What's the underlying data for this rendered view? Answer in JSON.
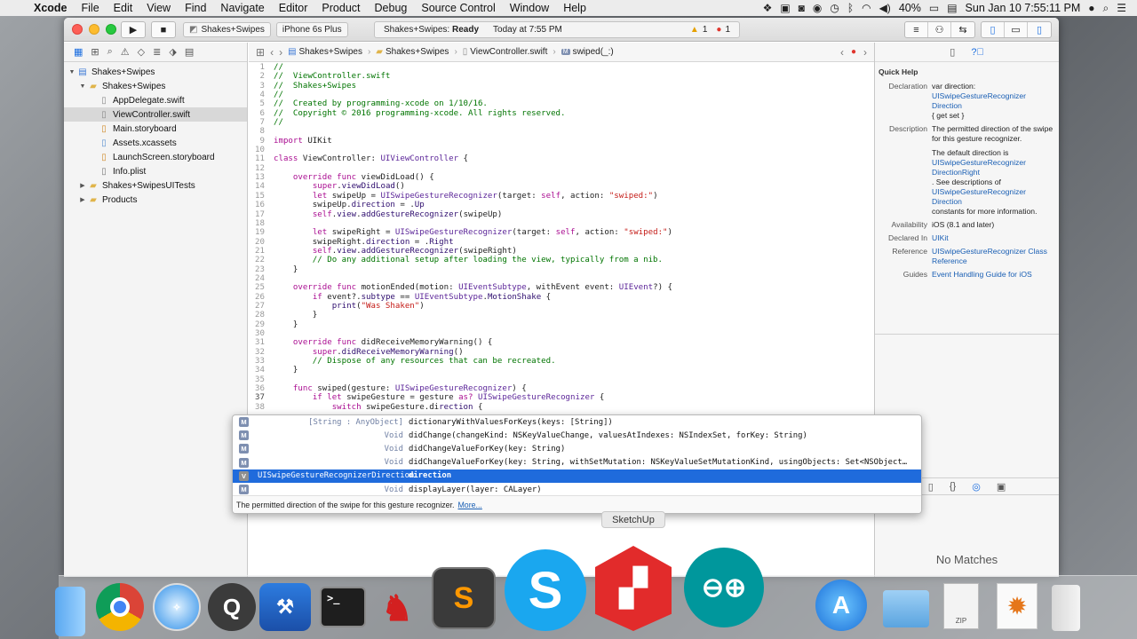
{
  "menubar": {
    "app": "Xcode",
    "items": [
      "File",
      "Edit",
      "View",
      "Find",
      "Navigate",
      "Editor",
      "Product",
      "Debug",
      "Source Control",
      "Window",
      "Help"
    ],
    "battery": "40%",
    "clock": "Sun Jan 10   7:55:11 PM"
  },
  "toolbar": {
    "scheme": "Shakes+Swipes",
    "device": "iPhone 6s Plus",
    "status_project": "Shakes+Swipes:",
    "status_state": "Ready",
    "status_time": "Today at 7:55 PM",
    "warnings": "1",
    "errors": "1"
  },
  "navigator": {
    "items": [
      {
        "label": "Shakes+Swipes",
        "level": 0,
        "arrow": "▼",
        "icon": "project-icon"
      },
      {
        "label": "Shakes+Swipes",
        "level": 1,
        "arrow": "▼",
        "icon": "folder-icon"
      },
      {
        "label": "AppDelegate.swift",
        "level": 2,
        "arrow": "",
        "icon": "swift-file-icon"
      },
      {
        "label": "ViewController.swift",
        "level": 2,
        "arrow": "",
        "icon": "swift-file-icon",
        "selected": true
      },
      {
        "label": "Main.storyboard",
        "level": 2,
        "arrow": "",
        "icon": "storyboard-icon"
      },
      {
        "label": "Assets.xcassets",
        "level": 2,
        "arrow": "",
        "icon": "assets-icon"
      },
      {
        "label": "LaunchScreen.storyboard",
        "level": 2,
        "arrow": "",
        "icon": "storyboard-icon"
      },
      {
        "label": "Info.plist",
        "level": 2,
        "arrow": "",
        "icon": "plist-icon"
      },
      {
        "label": "Shakes+SwipesUITests",
        "level": 1,
        "arrow": "▶",
        "icon": "folder-icon"
      },
      {
        "label": "Products",
        "level": 1,
        "arrow": "▶",
        "icon": "folder-icon"
      }
    ]
  },
  "jumpbar": {
    "crumbs": [
      "Shakes+Swipes",
      "Shakes+Swipes",
      "ViewController.swift",
      "swiped(_:)"
    ]
  },
  "code": {
    "lines": [
      [
        [
          "c",
          "//"
        ]
      ],
      [
        [
          "c",
          "//  ViewController.swift"
        ]
      ],
      [
        [
          "c",
          "//  Shakes+Swipes"
        ]
      ],
      [
        [
          "c",
          "//"
        ]
      ],
      [
        [
          "c",
          "//  Created by programming-xcode on 1/10/16."
        ]
      ],
      [
        [
          "c",
          "//  Copyright © 2016 programming-xcode. All rights reserved."
        ]
      ],
      [
        [
          "c",
          "//"
        ]
      ],
      [],
      [
        [
          "k",
          "import"
        ],
        [
          "ct",
          " UIKit"
        ]
      ],
      [],
      [
        [
          "k",
          "class"
        ],
        [
          "ct",
          " ViewController: "
        ],
        [
          "t",
          "UIViewController"
        ],
        [
          "ct",
          " {"
        ]
      ],
      [],
      [
        [
          "ct",
          "    "
        ],
        [
          "k",
          "override func"
        ],
        [
          "ct",
          " viewDidLoad() {"
        ]
      ],
      [
        [
          "ct",
          "        "
        ],
        [
          "k",
          "super"
        ],
        [
          "ct",
          "."
        ],
        [
          "f",
          "viewDidLoad"
        ],
        [
          "ct",
          "()"
        ]
      ],
      [
        [
          "ct",
          "        "
        ],
        [
          "k",
          "let"
        ],
        [
          "ct",
          " swipeUp = "
        ],
        [
          "t",
          "UISwipeGestureRecognizer"
        ],
        [
          "ct",
          "(target: "
        ],
        [
          "k",
          "self"
        ],
        [
          "ct",
          ", action: "
        ],
        [
          "s",
          "\"swiped:\""
        ],
        [
          "ct",
          ")"
        ]
      ],
      [
        [
          "ct",
          "        swipeUp."
        ],
        [
          "f",
          "direction"
        ],
        [
          "ct",
          " = ."
        ],
        [
          "f",
          "Up"
        ]
      ],
      [
        [
          "ct",
          "        "
        ],
        [
          "k",
          "self"
        ],
        [
          "ct",
          "."
        ],
        [
          "f",
          "view"
        ],
        [
          "ct",
          "."
        ],
        [
          "f",
          "addGestureRecognizer"
        ],
        [
          "ct",
          "(swipeUp)"
        ]
      ],
      [],
      [
        [
          "ct",
          "        "
        ],
        [
          "k",
          "let"
        ],
        [
          "ct",
          " swipeRight = "
        ],
        [
          "t",
          "UISwipeGestureRecognizer"
        ],
        [
          "ct",
          "(target: "
        ],
        [
          "k",
          "self"
        ],
        [
          "ct",
          ", action: "
        ],
        [
          "s",
          "\"swiped:\""
        ],
        [
          "ct",
          ")"
        ]
      ],
      [
        [
          "ct",
          "        swipeRight."
        ],
        [
          "f",
          "direction"
        ],
        [
          "ct",
          " = ."
        ],
        [
          "f",
          "Right"
        ]
      ],
      [
        [
          "ct",
          "        "
        ],
        [
          "k",
          "self"
        ],
        [
          "ct",
          "."
        ],
        [
          "f",
          "view"
        ],
        [
          "ct",
          "."
        ],
        [
          "f",
          "addGestureRecognizer"
        ],
        [
          "ct",
          "(swipeRight)"
        ]
      ],
      [
        [
          "c",
          "        // Do any additional setup after loading the view, typically from a nib."
        ]
      ],
      [
        [
          "ct",
          "    }"
        ]
      ],
      [],
      [
        [
          "ct",
          "    "
        ],
        [
          "k",
          "override func"
        ],
        [
          "ct",
          " motionEnded(motion: "
        ],
        [
          "t",
          "UIEventSubtype"
        ],
        [
          "ct",
          ", withEvent event: "
        ],
        [
          "t",
          "UIEvent"
        ],
        [
          "ct",
          "?) {"
        ]
      ],
      [
        [
          "ct",
          "        "
        ],
        [
          "k",
          "if"
        ],
        [
          "ct",
          " event?."
        ],
        [
          "f",
          "subtype"
        ],
        [
          "ct",
          " == "
        ],
        [
          "t",
          "UIEventSubtype"
        ],
        [
          "ct",
          "."
        ],
        [
          "f",
          "MotionShake"
        ],
        [
          "ct",
          " {"
        ]
      ],
      [
        [
          "ct",
          "            "
        ],
        [
          "f",
          "print"
        ],
        [
          "ct",
          "("
        ],
        [
          "s",
          "\"Was Shaken\""
        ],
        [
          "ct",
          ")"
        ]
      ],
      [
        [
          "ct",
          "        }"
        ]
      ],
      [
        [
          "ct",
          "    }"
        ]
      ],
      [],
      [
        [
          "ct",
          "    "
        ],
        [
          "k",
          "override func"
        ],
        [
          "ct",
          " didReceiveMemoryWarning() {"
        ]
      ],
      [
        [
          "ct",
          "        "
        ],
        [
          "k",
          "super"
        ],
        [
          "ct",
          "."
        ],
        [
          "f",
          "didReceiveMemoryWarning"
        ],
        [
          "ct",
          "()"
        ]
      ],
      [
        [
          "c",
          "        // Dispose of any resources that can be recreated."
        ]
      ],
      [
        [
          "ct",
          "    }"
        ]
      ],
      [],
      [
        [
          "ct",
          "    "
        ],
        [
          "k",
          "func"
        ],
        [
          "ct",
          " swiped(gesture: "
        ],
        [
          "t",
          "UISwipeGestureRecognizer"
        ],
        [
          "ct",
          ") {"
        ]
      ],
      [
        [
          "ct",
          "        "
        ],
        [
          "k",
          "if let"
        ],
        [
          "ct",
          " swipeGesture = gesture "
        ],
        [
          "k",
          "as?"
        ],
        [
          "ct",
          " "
        ],
        [
          "t",
          "UISwipeGestureRecognizer"
        ],
        [
          "ct",
          " {"
        ]
      ],
      [
        [
          "ct",
          "            "
        ],
        [
          "k",
          "switch"
        ],
        [
          "ct",
          " swipeGesture.di"
        ],
        [
          "f",
          "rection"
        ],
        [
          "ct",
          " {"
        ]
      ]
    ]
  },
  "completion": {
    "rows": [
      {
        "kind": "M",
        "ret": "[String : AnyObject]",
        "sig": "dictionaryWithValuesForKeys(keys: [String])"
      },
      {
        "kind": "M",
        "ret": "Void",
        "sig": "didChange(changeKind: NSKeyValueChange, valuesAtIndexes: NSIndexSet, forKey: String)"
      },
      {
        "kind": "M",
        "ret": "Void",
        "sig": "didChangeValueForKey(key: String)"
      },
      {
        "kind": "M",
        "ret": "Void",
        "sig": "didChangeValueForKey(key: String, withSetMutation: NSKeyValueSetMutationKind, usingObjects: Set<NSObject…"
      },
      {
        "kind": "V",
        "ret": "UISwipeGestureRecognizerDirection",
        "sig": "direction",
        "selected": true
      },
      {
        "kind": "M",
        "ret": "Void",
        "sig": "displayLayer(layer: CALayer)"
      }
    ],
    "description": "The permitted direction of the swipe for this gesture recognizer.",
    "more": "More..."
  },
  "tooltip": "SketchUp",
  "quick_help": {
    "title": "Quick Help",
    "declaration_key": "Declaration",
    "declaration": [
      "var direction:",
      "UISwipeGestureRecognizer",
      "Direction",
      "{ get set }"
    ],
    "description_key": "Description",
    "description_1": "The permitted direction of the swipe for this gesture recognizer.",
    "description_2a": "The default direction is",
    "description_2b": "UISwipeGestureRecognizer DirectionRight",
    "description_2c": ". See descriptions of",
    "description_2d": "UISwipeGestureRecognizer Direction",
    "description_2e": "constants for more information.",
    "availability_key": "Availability",
    "availability": "iOS (8.1 and later)",
    "declared_key": "Declared In",
    "declared": "UIKit",
    "reference_key": "Reference",
    "reference": "UISwipeGestureRecognizer Class Reference",
    "guides_key": "Guides",
    "guides": "Event Handling Guide for iOS"
  },
  "library": {
    "empty": "No Matches"
  },
  "dock": {
    "zip_label": "ZIP"
  }
}
